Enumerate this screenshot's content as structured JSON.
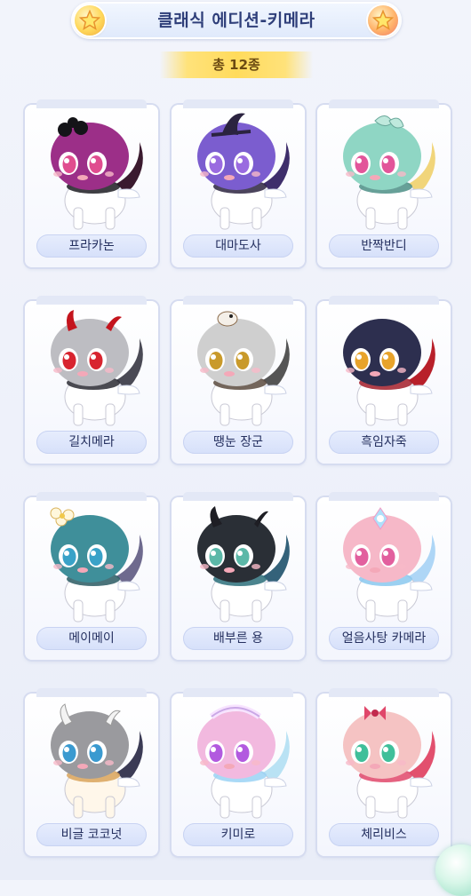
{
  "header": {
    "title": "클래식 에디션-키메라"
  },
  "count": {
    "text": "총 12종"
  },
  "colors": {
    "accent": "#2f3f7a",
    "ribbon": "#ffdb5c",
    "card_border": "#d6dcf0"
  },
  "characters": [
    {
      "label": "프라카논",
      "body": "#9c2f88",
      "belly": "#ffffff",
      "accent": "#1c1c22",
      "eye": "#e04d8f",
      "tail": "#3a1a2f",
      "deco": "sunglasses"
    },
    {
      "label": "대마도사",
      "body": "#7b5dcf",
      "belly": "#ffffff",
      "accent": "#2b2340",
      "eye": "#9a6be0",
      "tail": "#3e2e6b",
      "deco": "hat"
    },
    {
      "label": "반짝반디",
      "body": "#8fd6c4",
      "belly": "#ffffff",
      "accent": "#4c8f86",
      "eye": "#e2559a",
      "tail": "#f1d57a",
      "deco": "leaf"
    },
    {
      "label": "길치메라",
      "body": "#bdbdc2",
      "belly": "#ffffff",
      "accent": "#2a2a33",
      "eye": "#d8242f",
      "tail": "#4a4a55",
      "deco": "horns-red"
    },
    {
      "label": "땡눈 장군",
      "body": "#cfcfcf",
      "belly": "#ffffff",
      "accent": "#5a4a3e",
      "eye": "#c99a2a",
      "tail": "#555555",
      "deco": "bird"
    },
    {
      "label": "흑임자죽",
      "body": "#2d2f4f",
      "belly": "#ffffff",
      "accent": "#a31e2a",
      "eye": "#e8a32a",
      "tail": "#b8202a",
      "deco": "none"
    },
    {
      "label": "메이메이",
      "body": "#3f8f9a",
      "belly": "#ffffff",
      "accent": "#2a5a63",
      "eye": "#39a2c8",
      "tail": "#6e6a8e",
      "deco": "flower"
    },
    {
      "label": "배부른 용",
      "body": "#2a2f36",
      "belly": "#ffffff",
      "accent": "#2c6f7a",
      "eye": "#5bb8a8",
      "tail": "#34627a",
      "deco": "horns-teal"
    },
    {
      "label": "얼음사탕 카메라",
      "body": "#f6b8c8",
      "belly": "#ffffff",
      "accent": "#8ac8ef",
      "eye": "#e25f9e",
      "tail": "#aed6f6",
      "deco": "crystal"
    },
    {
      "label": "비글 코코넛",
      "body": "#9a9a9e",
      "belly": "#fff7ea",
      "accent": "#d9a35a",
      "eye": "#3a9ad0",
      "tail": "#3b3b55",
      "deco": "horns-white"
    },
    {
      "label": "키미로",
      "body": "#f2b9df",
      "belly": "#ffffff",
      "accent": "#9ad2f4",
      "eye": "#b25adf",
      "tail": "#b9e2f4",
      "deco": "wreath"
    },
    {
      "label": "체리비스",
      "body": "#f5c3c3",
      "belly": "#ffffff",
      "accent": "#e0466a",
      "eye": "#3fbf9a",
      "tail": "#e2506e",
      "deco": "bow"
    }
  ]
}
